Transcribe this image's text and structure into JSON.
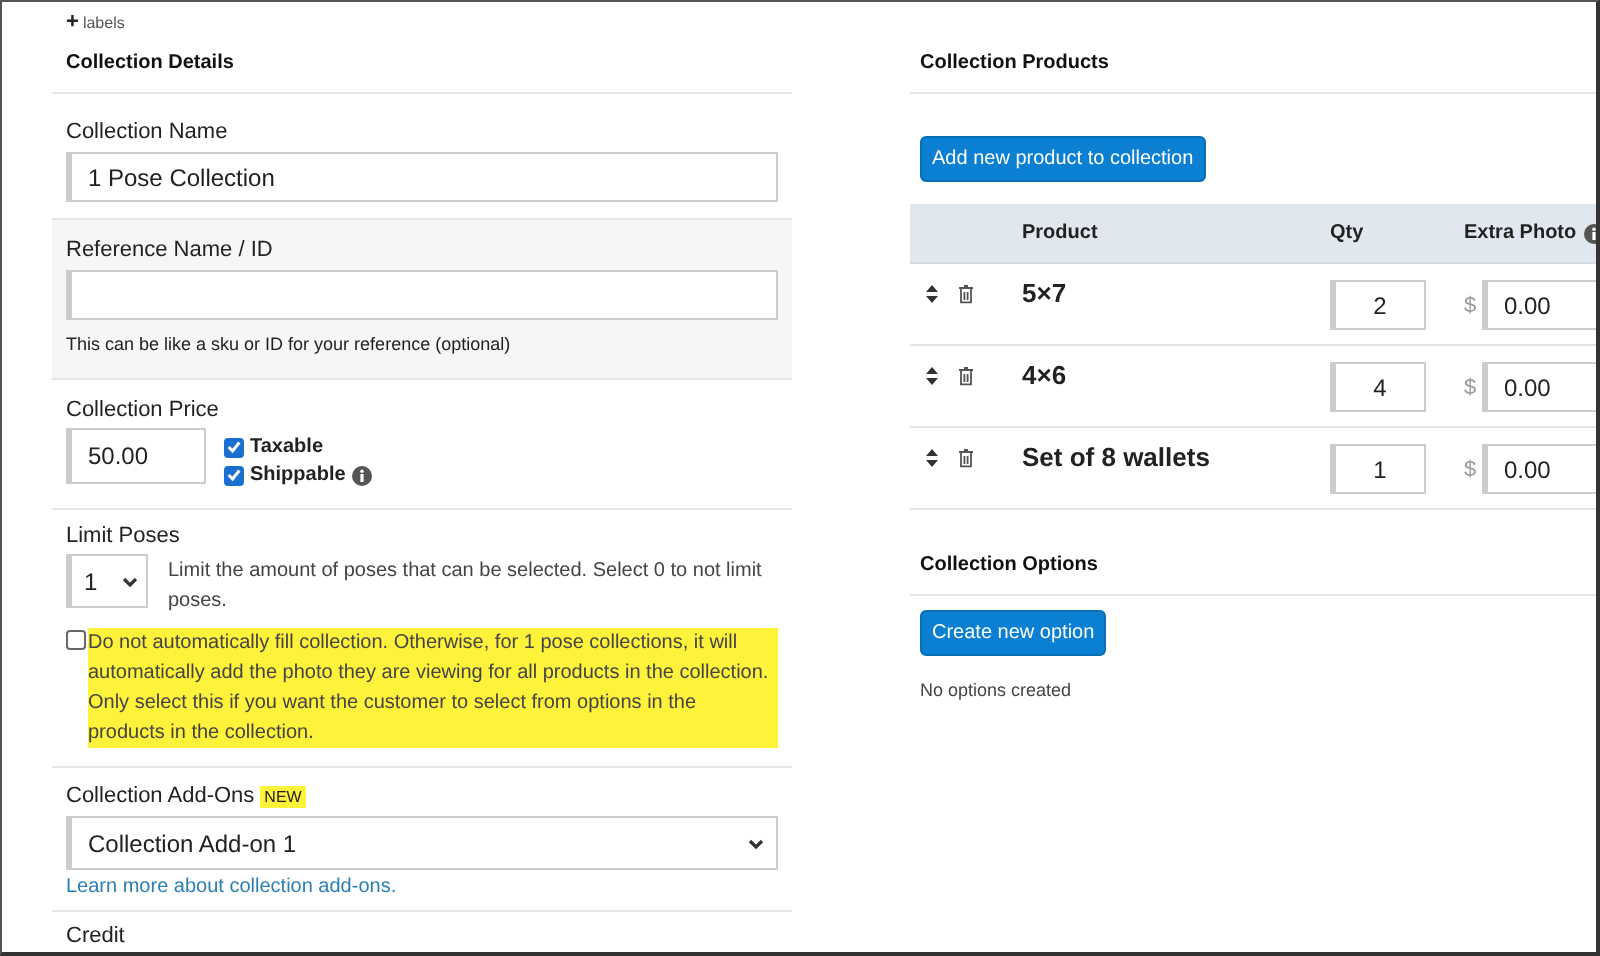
{
  "labels_toggle": {
    "icon": "+",
    "label": "labels"
  },
  "collection_details": {
    "title": "Collection Details",
    "name_field": {
      "label": "Collection Name",
      "value": "1 Pose Collection"
    },
    "reference_field": {
      "label": "Reference Name / ID",
      "help": "This can be like a sku or ID for your reference (optional)"
    },
    "price": {
      "label": "Collection Price",
      "value": "50.00",
      "options": [
        {
          "label": "Taxable",
          "checked": true,
          "info": false
        },
        {
          "label": "Shippable",
          "checked": true,
          "info": true
        }
      ]
    },
    "limit_poses": {
      "label": "Limit Poses",
      "value": "1",
      "help": "Limit the amount of poses that can be selected. Select 0 to not limit poses."
    },
    "auto_fill": {
      "checked": false,
      "highlighted": true,
      "text": "Do not automatically fill collection. Otherwise, for 1 pose collections, it will automatically add the photo they are viewing for all products in the collection. Only select this if you want the customer to select from options in the products in the collection."
    },
    "add_ons": {
      "label": "Collection Add-Ons",
      "badge": "NEW",
      "value": "Collection Add-on 1",
      "link": "Learn more about collection add-ons."
    },
    "credit": {
      "label": "Credit"
    }
  },
  "collection_products": {
    "title": "Collection Products",
    "add_button": "Add new product to collection",
    "columns": [
      "Product",
      "Qty",
      "Extra Photo"
    ],
    "rows": [
      {
        "product": "5×7",
        "qty": "2",
        "currency": "$",
        "extra_photo": "0.00"
      },
      {
        "product": "4×6",
        "qty": "4",
        "currency": "$",
        "extra_photo": "0.00"
      },
      {
        "product": "Set of 8 wallets",
        "qty": "1",
        "currency": "$",
        "extra_photo": "0.00"
      }
    ]
  },
  "collection_options": {
    "title": "Collection Options",
    "button": "Create new option",
    "empty_text": "No options created"
  }
}
